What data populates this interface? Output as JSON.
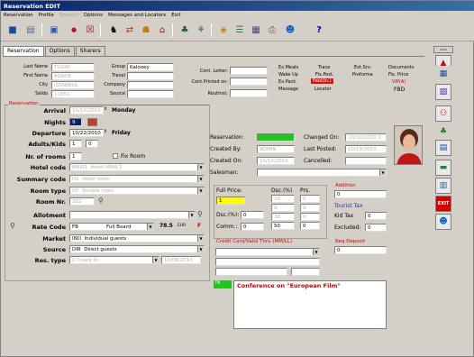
{
  "window": {
    "title": "Reservation EDIT"
  },
  "menu": [
    "Reservation",
    "Profile",
    "Sharers",
    "Options",
    "Messages and Locators",
    "Exit"
  ],
  "tabs": [
    "Reservation",
    "Options",
    "Sharers"
  ],
  "guest": {
    "last_name_label": "Last Name",
    "last_name": "TUGAY",
    "first_name_label": "First Name",
    "first_name": "AZADE",
    "city_label": "City",
    "city": "ISTANBUL",
    "saldo_label": "Saldo",
    "saldo": "11651",
    "group_label": "Group",
    "group": "Kalooey",
    "travel_label": "Travel",
    "travel": "",
    "company_label": "Company",
    "company": "",
    "source_label": "Source",
    "source": ""
  },
  "cont": {
    "letter_label": "Cont. Letter:",
    "printed_label": "Cont.Printed on:",
    "routinst_label": "RoutInst:"
  },
  "flags": {
    "col1": [
      "Ex.Meals",
      "Wake Up",
      "Ex.Pack.",
      "Message"
    ],
    "col2": [
      "Trace",
      "Fix.Post.",
      "Paid(In.)",
      "Locator"
    ],
    "col3": [
      "Ext.Srv.",
      "Proforma"
    ],
    "col4": [
      "Documents",
      "Fix. Price",
      "VIP(A)",
      "FBD"
    ]
  },
  "reservation_group": "Reservation",
  "res": {
    "arrival_label": "Arrival",
    "arrival": "10/10/2010",
    "arrival_day": "Monday",
    "nights_label": "Nights",
    "nights": "9",
    "departure_label": "Departure",
    "departure": "10/22/2010",
    "departure_day": "Friday",
    "adults_label": "Adults/Kids",
    "adults": "1",
    "kids": "0",
    "rooms_label": "Nr. of rooms",
    "rooms": "1",
    "fix_room": "Fix Room",
    "hotel_label": "Hotel code",
    "hotel_code": "MAIS1",
    "hotel_name": "Hotel MAIS 1",
    "summary_label": "Summary code",
    "summary_code": "HS",
    "summary_name": "Hotel room",
    "roomtype_label": "Room type",
    "roomtype_code": "DP",
    "roomtype_name": "Double room",
    "roomnr_label": "Room Nr.",
    "roomnr": "202",
    "allotment_label": "Allotment",
    "allotment": "",
    "rate_label": "Rate Code",
    "rate_code": "FB",
    "rate_name": "Full Board",
    "rate_value": "78.5",
    "rate_cur": "EUR",
    "rate_flag": "F",
    "market_label": "Market",
    "market_code": "IND",
    "market_name": "Individual guests",
    "source_label": "Source",
    "source_code": "DIR",
    "source_name": "Direct guests",
    "restype_label": "Res. type",
    "restype": "0  Check In",
    "restype_date": "10/08/2010"
  },
  "info": {
    "reservation_label": "Reservation:",
    "reservation": "",
    "created_by_label": "Created By:",
    "created_by": "ADMIN",
    "created_on_label": "Created On:",
    "created_on": "10/10/2010",
    "salesman_label": "Salesman:",
    "salesman": "",
    "changed_on_label": "Changed On:",
    "changed_on": "10/20/2010 2",
    "last_posted_label": "Last Posted:",
    "last_posted": "10/19/2010",
    "cancelled_label": "Cancelled:",
    "cancelled": ""
  },
  "price": {
    "full_price_label": "Full Price:",
    "full_price": "1",
    "dsc_label": "Dsc.(%)",
    "prs_label": "Prs.",
    "dsc_vals": [
      "10",
      "0",
      "30",
      "50"
    ],
    "prs_vals": [
      "0",
      "0",
      "0",
      "0"
    ],
    "dscp_label": "Dsc.(%):",
    "dscp": "0",
    "comm_label": "Comm.:",
    "comm": "0"
  },
  "addition": {
    "title": "Addition",
    "value": "0"
  },
  "tourist_tax": {
    "title": "Tourist Tax",
    "kid_tax_label": "Kid Tax",
    "kid_tax": "0",
    "excluded_label": "Excluded:",
    "excluded": "0"
  },
  "credit_card_title": "Credit Card/Valid Thru (MM/LL)",
  "req_deposit": {
    "title": "Req.Deposit",
    "value": "0"
  },
  "note": {
    "code": "IN",
    "text": "Conference on \"European Film\""
  },
  "colors": {
    "title_bar": "#0a246a",
    "accent_red": "#d40000",
    "highlight_green": "#21c421",
    "highlight_yellow": "#ffff00",
    "paid_red": "#e01010"
  }
}
